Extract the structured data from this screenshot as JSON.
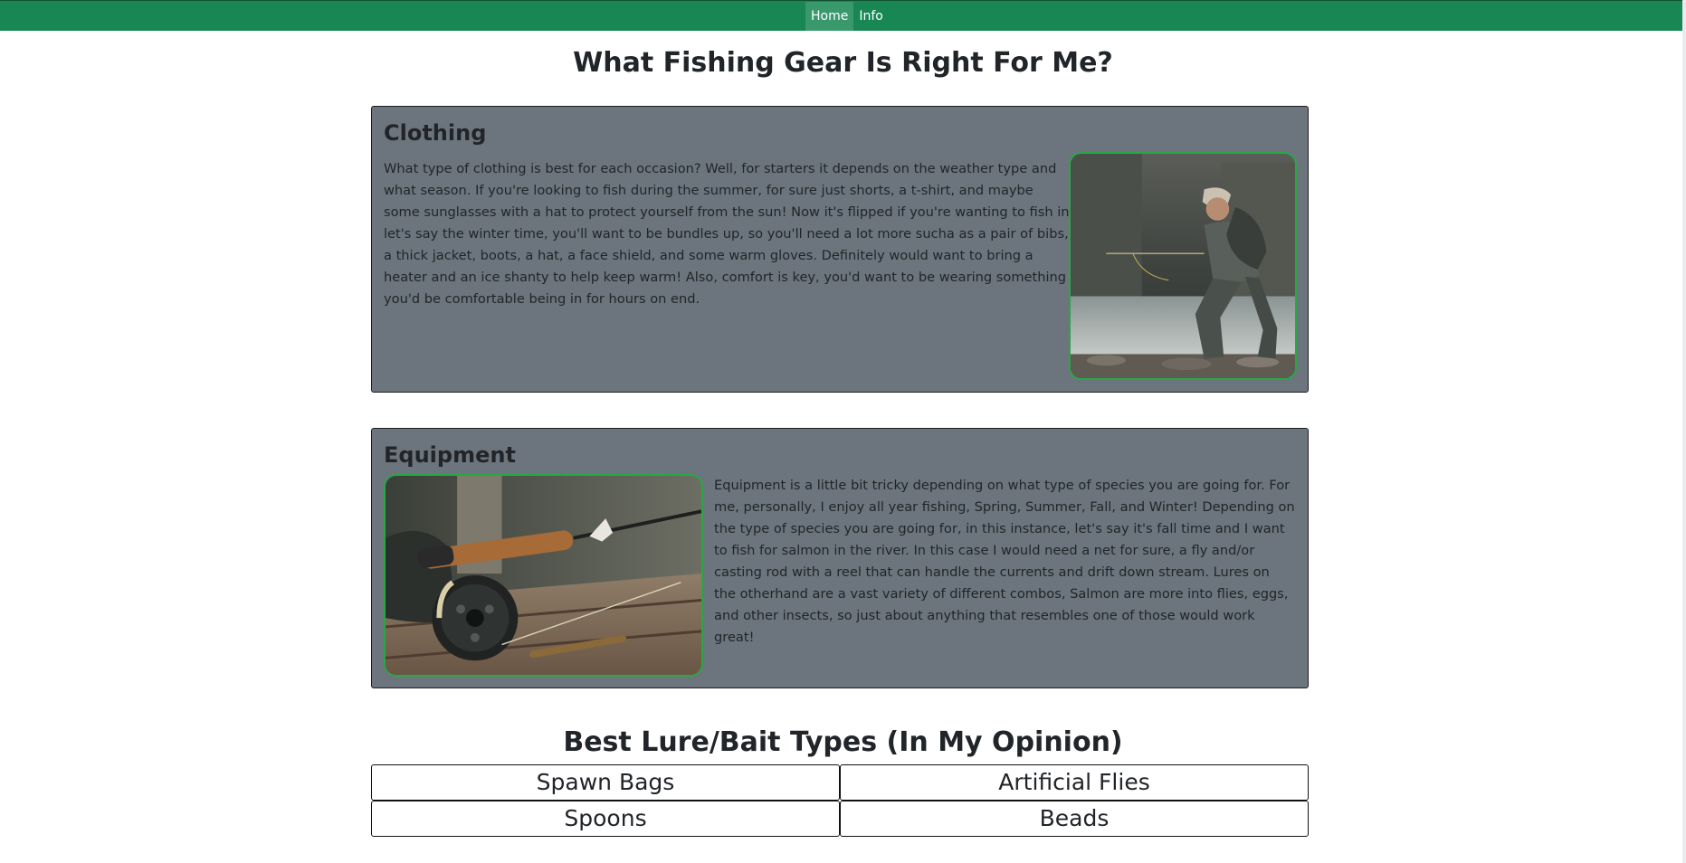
{
  "nav": {
    "items": [
      {
        "label": "Home"
      },
      {
        "label": "Info"
      }
    ]
  },
  "page": {
    "title": "What Fishing Gear Is Right For Me?"
  },
  "clothing": {
    "heading": "Clothing",
    "text": "What type of clothing is best for each occasion? Well, for starters it depends on the weather type and what season. If you're looking to fish during the summer, for sure just shorts, a t-shirt, and maybe some sunglasses with a hat to protect yourself from the sun! Now it's flipped if you're wanting to fish in let's say the winter time, you'll want to be bundles up, so you'll need a lot more sucha as a pair of bibs, a thick jacket, boots, a hat, a face shield, and some warm gloves. Definitely would want to bring a heater and an ice shanty to help keep warm! Also, comfort is key, you'd want to be wearing something you'd be comfortable being in for hours on end."
  },
  "equipment": {
    "heading": "Equipment",
    "text": "Equipment is a little bit tricky depending on what type of species you are going for. For me, personally, I enjoy all year fishing, Spring, Summer, Fall, and Winter! Depending on the type of species you are going for, in this instance, let's say it's fall time and I want to fish for salmon in the river. In this case I would need a net for sure, a fly and/or casting rod with a reel that can handle the currents and drift down stream. Lures on the otherhand are a vast variety of different combos, Salmon are more into flies, eggs, and other insects, so just about anything that resembles one of those would work great!"
  },
  "lures": {
    "title": "Best Lure/Bait Types (In My Opinion)",
    "items": [
      "Spawn Bags",
      "Artificial Flies",
      "Spoons",
      "Beads"
    ]
  },
  "colors": {
    "navbar": "#198754",
    "card": "#6c757d",
    "image_border": "#28a745"
  }
}
